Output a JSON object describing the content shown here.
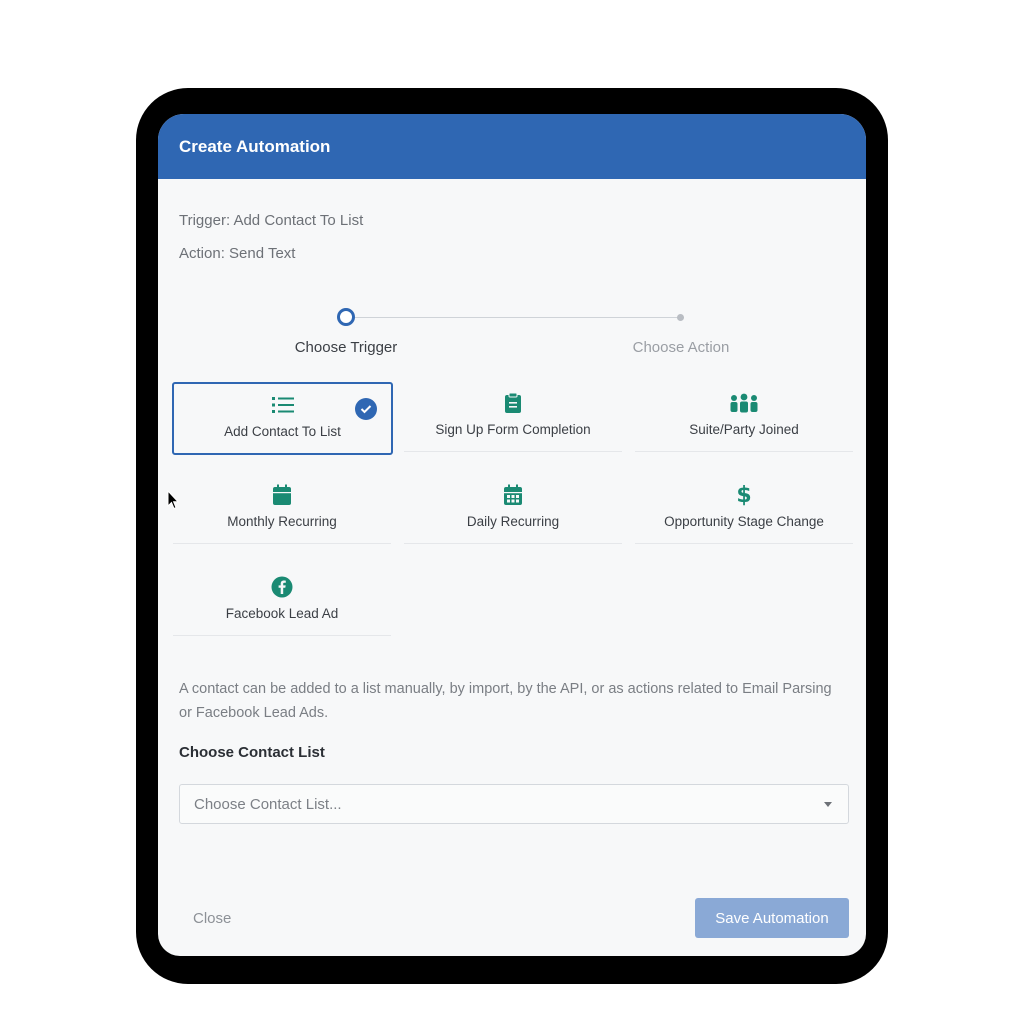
{
  "modal": {
    "title": "Create Automation"
  },
  "summary": {
    "trigger_line": "Trigger: Add Contact To List",
    "action_line": "Action: Send Text"
  },
  "stepper": {
    "steps": [
      {
        "label": "Choose Trigger",
        "state": "active"
      },
      {
        "label": "Choose Action",
        "state": "inactive"
      }
    ]
  },
  "triggers": [
    {
      "label": "Add Contact To List",
      "icon": "list-icon",
      "selected": true
    },
    {
      "label": "Sign Up Form Completion",
      "icon": "clipboard-icon",
      "selected": false
    },
    {
      "label": "Suite/Party Joined",
      "icon": "group-icon",
      "selected": false
    },
    {
      "label": "Monthly Recurring",
      "icon": "calendar-icon",
      "selected": false
    },
    {
      "label": "Daily Recurring",
      "icon": "calendar-grid-icon",
      "selected": false
    },
    {
      "label": "Opportunity Stage Change",
      "icon": "dollar-icon",
      "selected": false
    },
    {
      "label": "Facebook Lead Ad",
      "icon": "facebook-icon",
      "selected": false
    }
  ],
  "description": "A contact can be added to a list manually, by import, by the API, or as actions related to Email Parsing or Facebook Lead Ads.",
  "contact_list": {
    "heading": "Choose Contact List",
    "placeholder": "Choose Contact List..."
  },
  "footer": {
    "close_label": "Close",
    "save_label": "Save Automation"
  },
  "colors": {
    "header": "#2f67b3",
    "icon_accent": "#1a8a73",
    "save_button": "#8aa9d6"
  }
}
